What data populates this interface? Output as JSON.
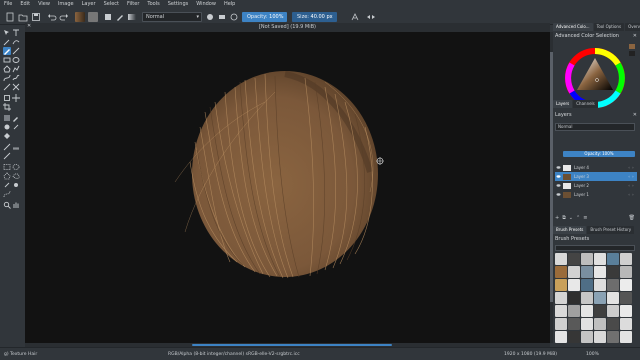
{
  "menu": [
    "File",
    "Edit",
    "View",
    "Image",
    "Layer",
    "Select",
    "Filter",
    "Tools",
    "Settings",
    "Window",
    "Help"
  ],
  "toolbar": {
    "blend_mode": "Normal",
    "opacity_label": "Opacity:",
    "opacity_value": "100%",
    "opacity_fraction": 1.0,
    "size_label": "Size:",
    "size_value": "40.00 px"
  },
  "canvas": {
    "title": "[Not Saved]  (19.9 MiB)"
  },
  "dock": {
    "top_tabs": [
      "Advanced Colo...",
      "Tool Options",
      "Overview"
    ],
    "color_panel_title": "Advanced Color Selection",
    "mid_tabs": [
      "Layers",
      "Channels"
    ],
    "layers_title": "Layers",
    "layers_blend": "Normal",
    "layers_opacity": "Opacity: 100%",
    "layers": [
      {
        "name": "Layer 4",
        "thumb": "light",
        "active": false
      },
      {
        "name": "Layer 3",
        "thumb": "dark",
        "active": true
      },
      {
        "name": "Layer 2",
        "thumb": "light",
        "active": false
      },
      {
        "name": "Layer 1",
        "thumb": "dark",
        "active": false
      }
    ],
    "bottom_tabs": [
      "Brush Presets",
      "Brush Preset History"
    ],
    "presets_title": "Brush Presets"
  },
  "status": {
    "left": "g) Texture Hair",
    "center": "RGB/Alpha (8-bit integer/channel)  sRGB-elle-V2-srgbtrc.icc",
    "right": "1920 x 1080 (19.9 MiB)",
    "zoom": "100%"
  },
  "colors": {
    "accent": "#3d83c4",
    "hair_base": "#8a6440",
    "hair_highlight": "#b38a5e",
    "canvas_bg": "#121212"
  }
}
